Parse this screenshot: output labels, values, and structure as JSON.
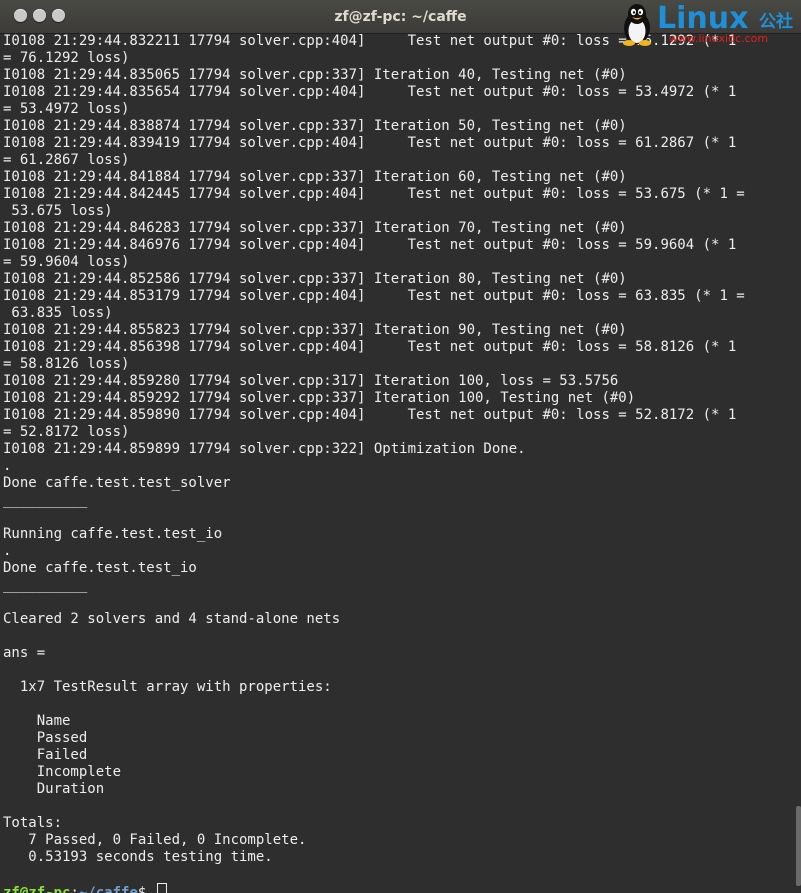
{
  "window": {
    "title": "zf@zf-pc: ~/caffe"
  },
  "watermark": {
    "brand": "Linux",
    "brand_cn": "公社",
    "url": "www.linuxidc.com"
  },
  "terminal": {
    "lines": [
      "I0108 21:29:44.832211 17794 solver.cpp:404]     Test net output #0: loss = 76.1292 (* 1",
      "= 76.1292 loss)",
      "I0108 21:29:44.835065 17794 solver.cpp:337] Iteration 40, Testing net (#0)",
      "I0108 21:29:44.835654 17794 solver.cpp:404]     Test net output #0: loss = 53.4972 (* 1",
      "= 53.4972 loss)",
      "I0108 21:29:44.838874 17794 solver.cpp:337] Iteration 50, Testing net (#0)",
      "I0108 21:29:44.839419 17794 solver.cpp:404]     Test net output #0: loss = 61.2867 (* 1",
      "= 61.2867 loss)",
      "I0108 21:29:44.841884 17794 solver.cpp:337] Iteration 60, Testing net (#0)",
      "I0108 21:29:44.842445 17794 solver.cpp:404]     Test net output #0: loss = 53.675 (* 1 =",
      " 53.675 loss)",
      "I0108 21:29:44.846283 17794 solver.cpp:337] Iteration 70, Testing net (#0)",
      "I0108 21:29:44.846976 17794 solver.cpp:404]     Test net output #0: loss = 59.9604 (* 1",
      "= 59.9604 loss)",
      "I0108 21:29:44.852586 17794 solver.cpp:337] Iteration 80, Testing net (#0)",
      "I0108 21:29:44.853179 17794 solver.cpp:404]     Test net output #0: loss = 63.835 (* 1 =",
      " 63.835 loss)",
      "I0108 21:29:44.855823 17794 solver.cpp:337] Iteration 90, Testing net (#0)",
      "I0108 21:29:44.856398 17794 solver.cpp:404]     Test net output #0: loss = 58.8126 (* 1",
      "= 58.8126 loss)",
      "I0108 21:29:44.859280 17794 solver.cpp:317] Iteration 100, loss = 53.5756",
      "I0108 21:29:44.859292 17794 solver.cpp:337] Iteration 100, Testing net (#0)",
      "I0108 21:29:44.859890 17794 solver.cpp:404]     Test net output #0: loss = 52.8172 (* 1",
      "= 52.8172 loss)",
      "I0108 21:29:44.859899 17794 solver.cpp:322] Optimization Done.",
      ".",
      "Done caffe.test.test_solver",
      "__________",
      "",
      "Running caffe.test.test_io",
      ".",
      "Done caffe.test.test_io",
      "__________",
      "",
      "Cleared 2 solvers and 4 stand-alone nets",
      "",
      "ans = ",
      "",
      "  1x7 TestResult array with properties:",
      "",
      "    Name",
      "    Passed",
      "    Failed",
      "    Incomplete",
      "    Duration",
      "",
      "Totals:",
      "   7 Passed, 0 Failed, 0 Incomplete.",
      "   0.53193 seconds testing time.",
      ""
    ],
    "prompt": {
      "user_host": "zf@zf-pc",
      "separator": ":",
      "path": "~/caffe",
      "symbol": "$ "
    }
  },
  "colors": {
    "background": "#2e2e2e",
    "text": "#ededed",
    "prompt_user": "#8ae234",
    "prompt_path": "#729fcf"
  }
}
